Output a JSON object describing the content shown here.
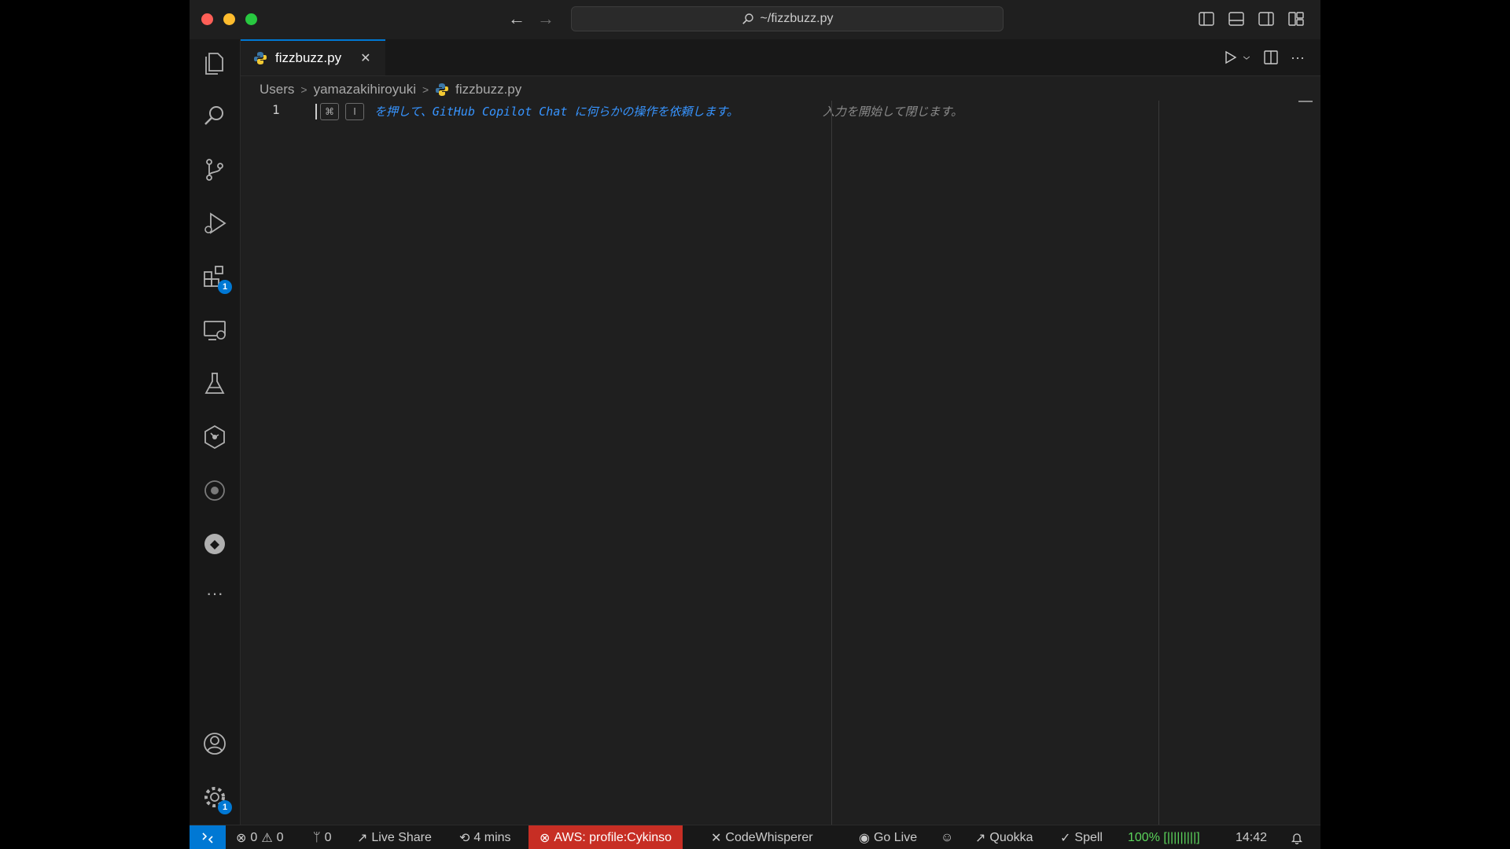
{
  "window": {
    "command_center": "~/fizzbuzz.py"
  },
  "activity_bar": {
    "extensions_badge": "1",
    "manage_badge": "1"
  },
  "tabs": [
    {
      "label": "fizzbuzz.py",
      "icon": "python-icon",
      "active": true
    }
  ],
  "breadcrumb": {
    "parts": [
      "Users",
      "yamazakihiroyuki",
      "fizzbuzz.py"
    ]
  },
  "editor": {
    "line_number": "1",
    "kbd_keys": [
      "⌘",
      "I"
    ],
    "hint_main": "を押して、GitHub Copilot Chat に何らかの操作を依頼します。",
    "hint_sub": "入力を開始して閉じます。"
  },
  "status_bar": {
    "errors": "0",
    "warnings": "0",
    "ports": "0",
    "live_share": "Live Share",
    "time_tracker": "4 mins",
    "aws": "AWS: profile:Cykinso",
    "codewhisperer": "CodeWhisperer",
    "go_live": "Go Live",
    "quokka": "Quokka",
    "spell": "Spell",
    "battery": "100% [|||||||||]",
    "clock": "14:42"
  },
  "colors": {
    "accent": "#0078d4",
    "aws_bg": "#c72e24",
    "hint": "#3794ff"
  }
}
